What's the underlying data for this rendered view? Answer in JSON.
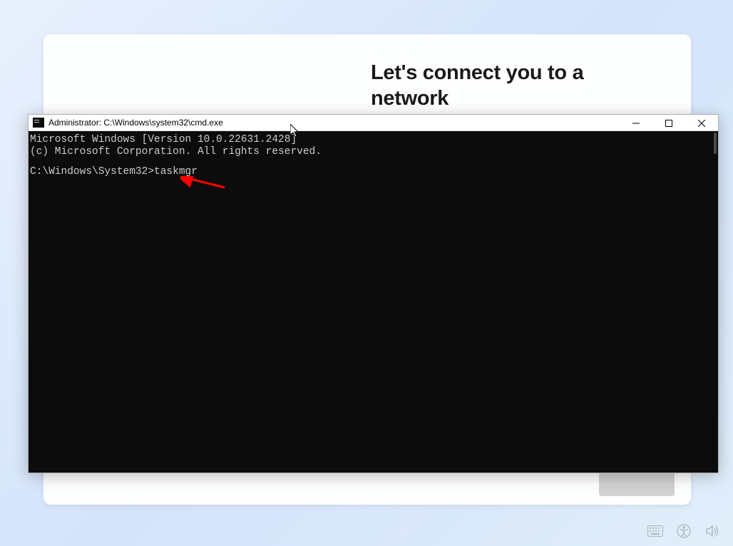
{
  "oobe": {
    "heading": "Let's connect you to a\nnetwork"
  },
  "cmd": {
    "title": "Administrator: C:\\Windows\\system32\\cmd.exe",
    "line1": "Microsoft Windows [Version 10.0.22631.2428]",
    "line2": "(c) Microsoft Corporation. All rights reserved.",
    "prompt": "C:\\Windows\\System32>",
    "command": "taskmgr"
  },
  "icons": {
    "minimize": "min",
    "maximize": "max",
    "close": "close",
    "keyboard": "keyboard",
    "accessibility": "accessibility",
    "volume": "volume"
  }
}
